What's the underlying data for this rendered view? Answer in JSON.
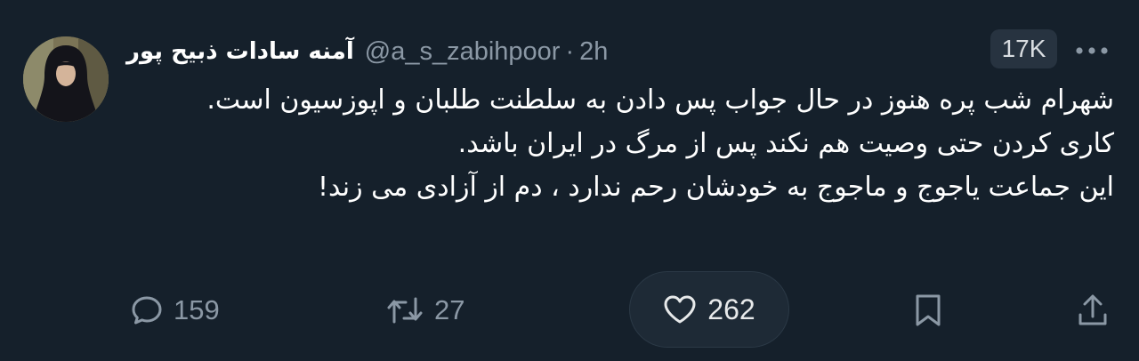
{
  "tweet": {
    "author": {
      "display_name": "آمنه سادات ذبیح پور",
      "handle": "@a_s_zabihpoor",
      "separator": "·",
      "time": "2h",
      "avatar_icon": "profile-photo"
    },
    "views_badge": "17K",
    "more_icon": "more-horizontal-icon",
    "body": {
      "line1": "شهرام شب پره هنوز در حال جواب پس دادن به سلطنت طلبان و اپوزسیون است.",
      "line2": "کاری کردن حتی وصیت هم نکند پس از مرگ در ایران باشد.",
      "line3": "این جماعت یاجوج و ماجوج به خودشان رحم ندارد ، دم از آزادی می زند!"
    },
    "actions": {
      "replies": "159",
      "retweets": "27",
      "likes": "262",
      "reply_icon": "reply-icon",
      "retweet_icon": "retweet-icon",
      "like_icon": "heart-icon",
      "bookmark_icon": "bookmark-icon",
      "share_icon": "share-icon"
    }
  },
  "colors": {
    "background": "#15202b",
    "text": "#ffffff",
    "secondary": "#8b98a5",
    "badge": "#273340"
  }
}
